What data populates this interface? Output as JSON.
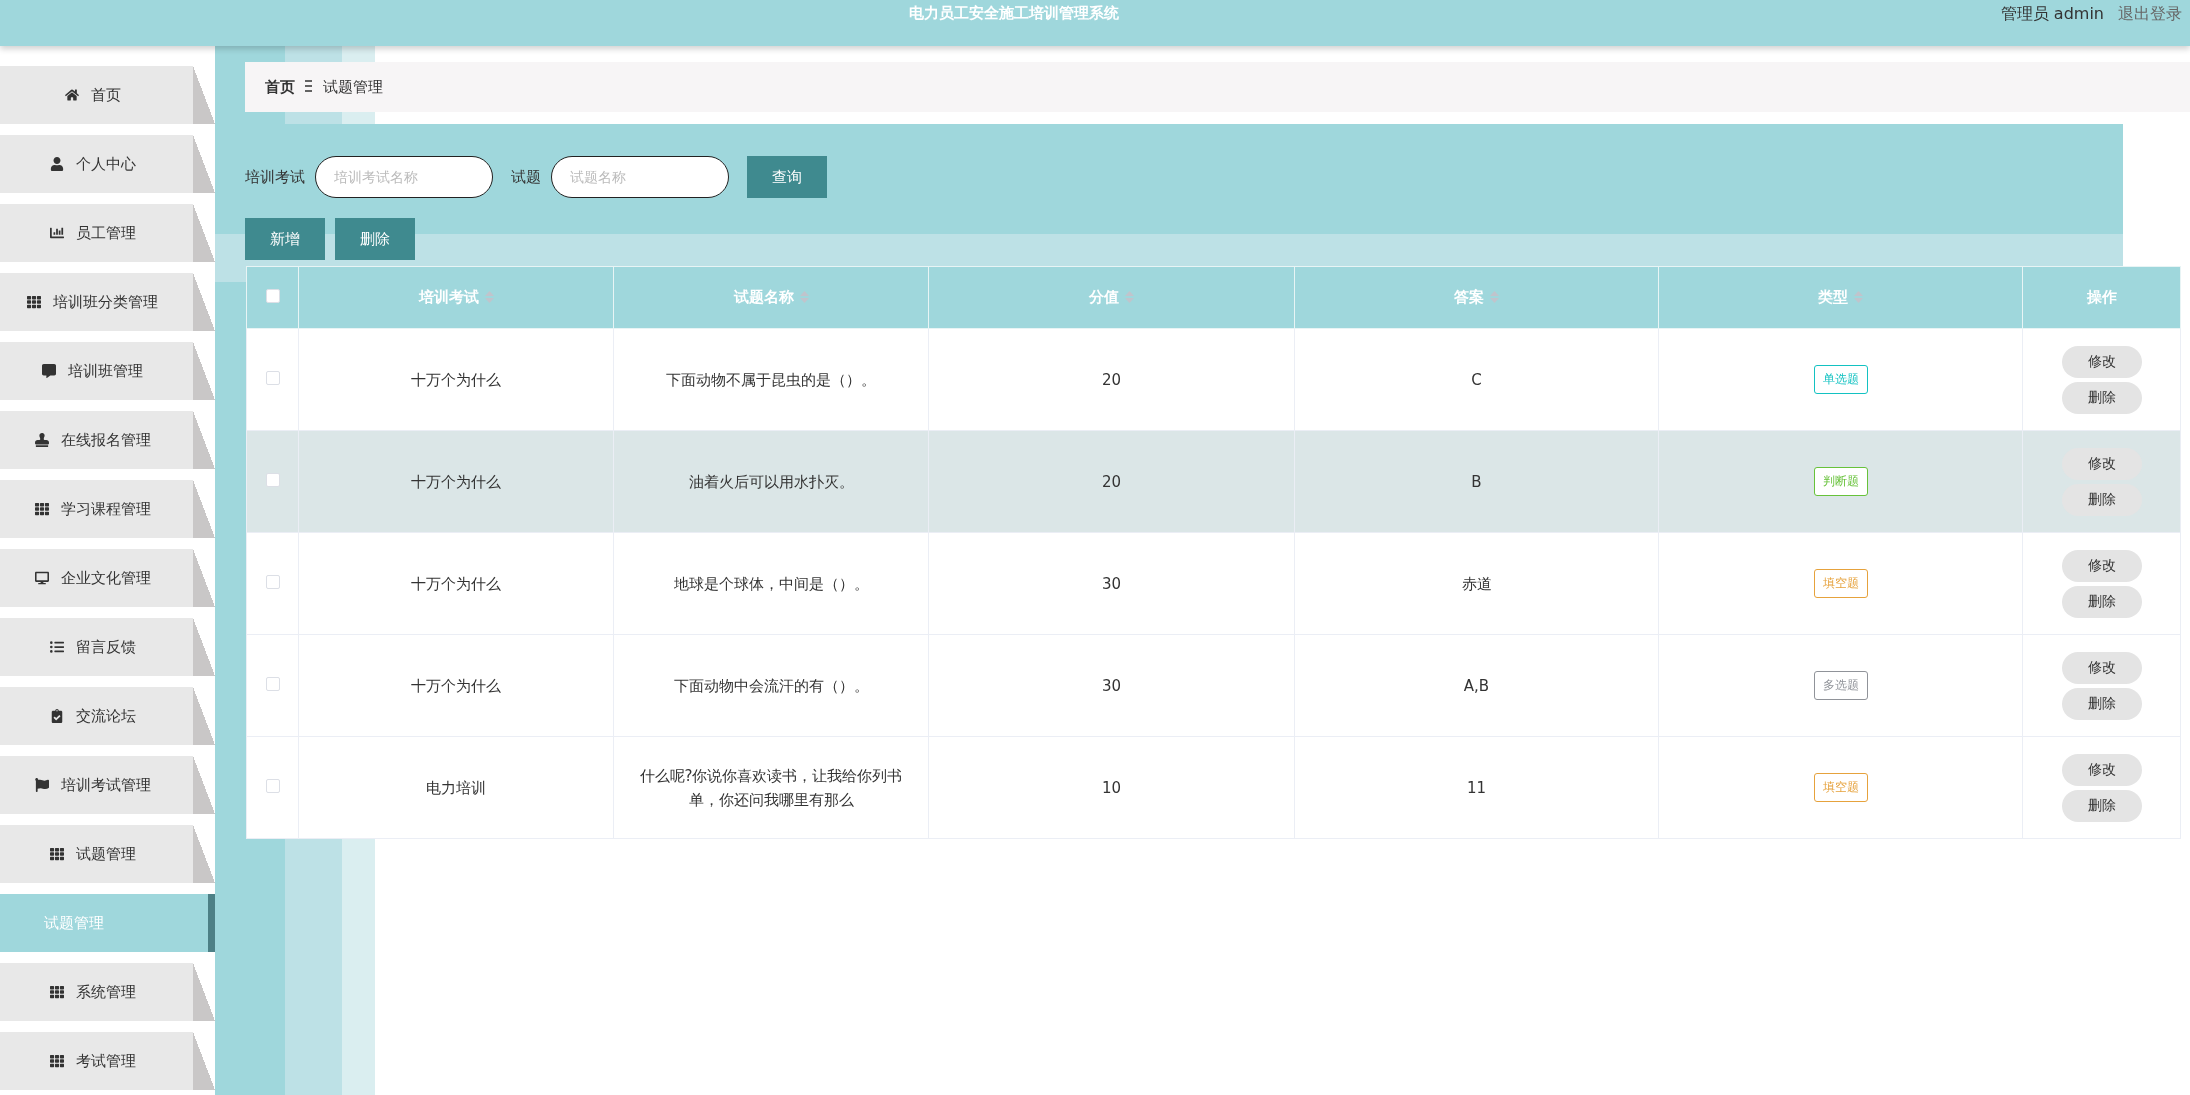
{
  "header": {
    "title": "电力员工安全施工培训管理系统",
    "user": "管理员 admin",
    "logout": "退出登录"
  },
  "sidebar": {
    "items": [
      {
        "label": "首页",
        "selected": false
      },
      {
        "label": "个人中心",
        "selected": false
      },
      {
        "label": "员工管理",
        "selected": false
      },
      {
        "label": "培训班分类管理",
        "selected": false
      },
      {
        "label": "培训班管理",
        "selected": false
      },
      {
        "label": "在线报名管理",
        "selected": false
      },
      {
        "label": "学习课程管理",
        "selected": false
      },
      {
        "label": "企业文化管理",
        "selected": false
      },
      {
        "label": "留言反馈",
        "selected": false
      },
      {
        "label": "交流论坛",
        "selected": false
      },
      {
        "label": "培训考试管理",
        "selected": false
      },
      {
        "label": "试题管理",
        "selected": false,
        "expanded": true,
        "children": [
          {
            "label": "试题管理",
            "selected": true
          }
        ]
      },
      {
        "label": "系统管理",
        "selected": false
      },
      {
        "label": "考试管理",
        "selected": false
      }
    ]
  },
  "breadcrumb": [
    "首页",
    "试题管理"
  ],
  "search": {
    "fields": [
      {
        "label": "培训考试",
        "placeholder": "培训考试名称"
      },
      {
        "label": "试题",
        "placeholder": "试题名称"
      }
    ],
    "button": "查询"
  },
  "actions": [
    "新增",
    "删除"
  ],
  "table": {
    "header_checked": false,
    "columns": [
      {
        "label": "培训考试",
        "sortable": true
      },
      {
        "label": "试题名称",
        "sortable": true
      },
      {
        "label": "分值",
        "sortable": true
      },
      {
        "label": "答案",
        "sortable": true
      },
      {
        "label": "类型",
        "sortable": true
      },
      {
        "label": "操作",
        "sortable": false
      }
    ],
    "rows": [
      {
        "checked": false,
        "hovered": false,
        "exam": "十万个为什么",
        "question": "下面动物不属于昆虫的是（）。",
        "score": "20",
        "answer": "C",
        "type": {
          "label": "单选题",
          "color": "#13c2c2"
        },
        "actions": [
          "修改",
          "删除"
        ]
      },
      {
        "checked": false,
        "hovered": true,
        "exam": "十万个为什么",
        "question": "油着火后可以用水扑灭。",
        "score": "20",
        "answer": "B",
        "type": {
          "label": "判断题",
          "color": "#67c23a"
        },
        "actions": [
          "修改",
          "删除"
        ]
      },
      {
        "checked": false,
        "hovered": false,
        "exam": "十万个为什么",
        "question": "地球是个球体，中间是（）。",
        "score": "30",
        "answer": "赤道",
        "type": {
          "label": "填空题",
          "color": "#e6a23c"
        },
        "actions": [
          "修改",
          "删除"
        ]
      },
      {
        "checked": false,
        "hovered": false,
        "exam": "十万个为什么",
        "question": "下面动物中会流汗的有（）。",
        "score": "30",
        "answer": "A,B",
        "type": {
          "label": "多选题",
          "color": "#909399"
        },
        "actions": [
          "修改",
          "删除"
        ]
      },
      {
        "checked": false,
        "hovered": false,
        "exam": "电力培训",
        "question": "什么呢?你说你喜欢读书，让我给你列书单，你还问我哪里有那么",
        "score": "10",
        "answer": "11",
        "type": {
          "label": "填空题",
          "color": "#e6a23c"
        },
        "actions": [
          "修改",
          "删除"
        ]
      }
    ]
  }
}
